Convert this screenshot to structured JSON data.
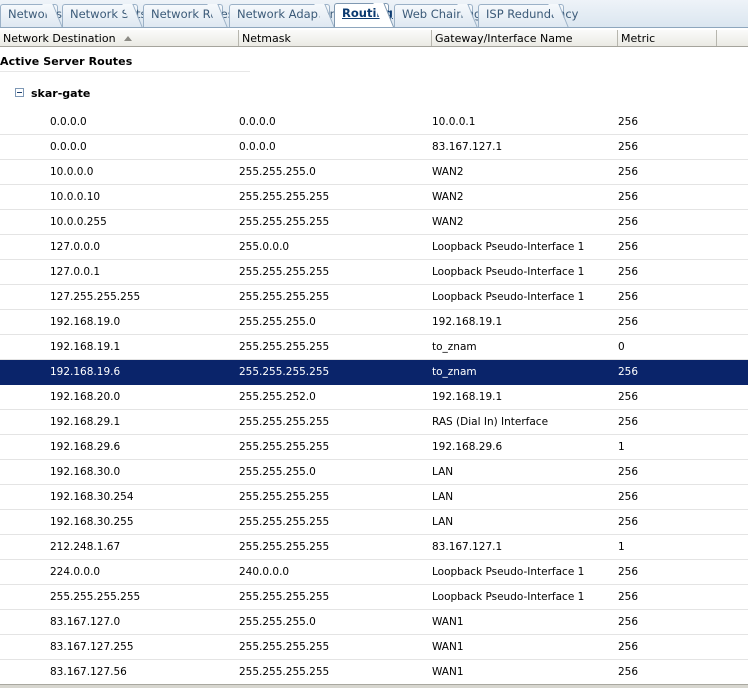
{
  "tabs": [
    {
      "label": "Networks",
      "active": false
    },
    {
      "label": "Network Sets",
      "active": false
    },
    {
      "label": "Network Rules",
      "active": false
    },
    {
      "label": "Network Adapters",
      "active": false
    },
    {
      "label": "Routing",
      "active": true
    },
    {
      "label": "Web Chaining",
      "active": false
    },
    {
      "label": "ISP Redundancy",
      "active": false
    }
  ],
  "columns": [
    {
      "label": "Network Destination",
      "sorted": "ascending"
    },
    {
      "label": "Netmask"
    },
    {
      "label": "Gateway/Interface Name"
    },
    {
      "label": "Metric"
    }
  ],
  "section": {
    "title": "Active Server Routes"
  },
  "group": {
    "name": "skar-gate",
    "expanded": true
  },
  "rows": [
    [
      "0.0.0.0",
      "0.0.0.0",
      "10.0.0.1",
      "256"
    ],
    [
      "0.0.0.0",
      "0.0.0.0",
      "83.167.127.1",
      "256"
    ],
    [
      "10.0.0.0",
      "255.255.255.0",
      "WAN2",
      "256"
    ],
    [
      "10.0.0.10",
      "255.255.255.255",
      "WAN2",
      "256"
    ],
    [
      "10.0.0.255",
      "255.255.255.255",
      "WAN2",
      "256"
    ],
    [
      "127.0.0.0",
      "255.0.0.0",
      "Loopback Pseudo-Interface 1",
      "256"
    ],
    [
      "127.0.0.1",
      "255.255.255.255",
      "Loopback Pseudo-Interface 1",
      "256"
    ],
    [
      "127.255.255.255",
      "255.255.255.255",
      "Loopback Pseudo-Interface 1",
      "256"
    ],
    [
      "192.168.19.0",
      "255.255.255.0",
      "192.168.19.1",
      "256"
    ],
    [
      "192.168.19.1",
      "255.255.255.255",
      "to_znam",
      "0"
    ],
    [
      "192.168.19.6",
      "255.255.255.255",
      "to_znam",
      "256"
    ],
    [
      "192.168.20.0",
      "255.255.252.0",
      "192.168.19.1",
      "256"
    ],
    [
      "192.168.29.1",
      "255.255.255.255",
      "RAS (Dial In) Interface",
      "256"
    ],
    [
      "192.168.29.6",
      "255.255.255.255",
      "192.168.29.6",
      "1"
    ],
    [
      "192.168.30.0",
      "255.255.255.0",
      "LAN",
      "256"
    ],
    [
      "192.168.30.254",
      "255.255.255.255",
      "LAN",
      "256"
    ],
    [
      "192.168.30.255",
      "255.255.255.255",
      "LAN",
      "256"
    ],
    [
      "212.248.1.67",
      "255.255.255.255",
      "83.167.127.1",
      "1"
    ],
    [
      "224.0.0.0",
      "240.0.0.0",
      "Loopback Pseudo-Interface 1",
      "256"
    ],
    [
      "255.255.255.255",
      "255.255.255.255",
      "Loopback Pseudo-Interface 1",
      "256"
    ],
    [
      "83.167.127.0",
      "255.255.255.0",
      "WAN1",
      "256"
    ],
    [
      "83.167.127.255",
      "255.255.255.255",
      "WAN1",
      "256"
    ],
    [
      "83.167.127.56",
      "255.255.255.255",
      "WAN1",
      "256"
    ]
  ],
  "selected_row_index": 10,
  "colors": {
    "selection": "#0a246a",
    "tab_text": "#3b5a78",
    "active_tab_text": "#0b3a70"
  }
}
